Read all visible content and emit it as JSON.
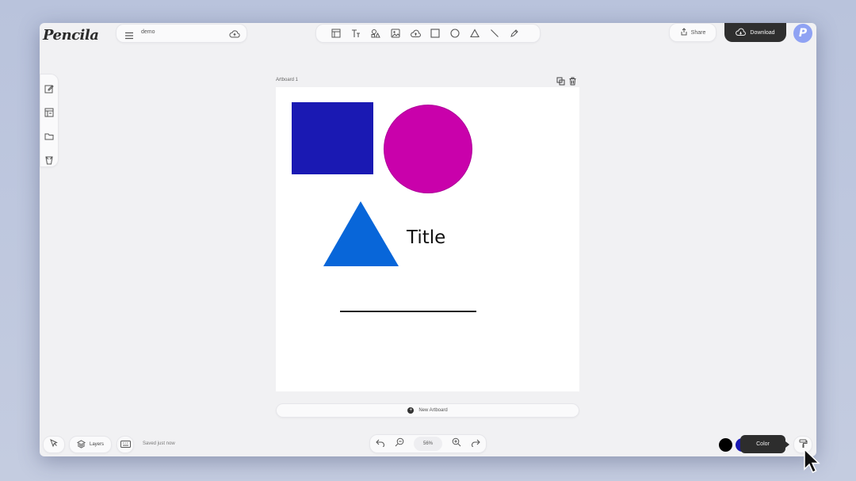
{
  "app": {
    "logo": "Pencila"
  },
  "file": {
    "name": "demo"
  },
  "header": {
    "share_label": "Share",
    "download_label": "Download",
    "avatar_letter": "P"
  },
  "toolbar": {
    "tools": [
      "template-icon",
      "text-icon",
      "shapes-icon",
      "image-icon",
      "upload-icon",
      "rectangle-icon",
      "circle-icon",
      "triangle-icon",
      "line-icon",
      "pen-icon"
    ]
  },
  "sidebar": {
    "items": [
      "edit-icon",
      "templates-icon",
      "folder-icon",
      "clear-icon"
    ]
  },
  "artboard": {
    "label": "Artboard 1",
    "title_text": "Title",
    "colors": {
      "square": "#1a19b3",
      "circle": "#c901ab",
      "triangle": "#0866d9",
      "line": "#222222"
    }
  },
  "new_artboard_label": "New Artboard",
  "bottom": {
    "layers_label": "Layers",
    "saved_status": "Saved just now",
    "zoom": "56%",
    "color_tooltip": "Color",
    "swatches": [
      "#000000",
      "#1a19b3"
    ]
  }
}
